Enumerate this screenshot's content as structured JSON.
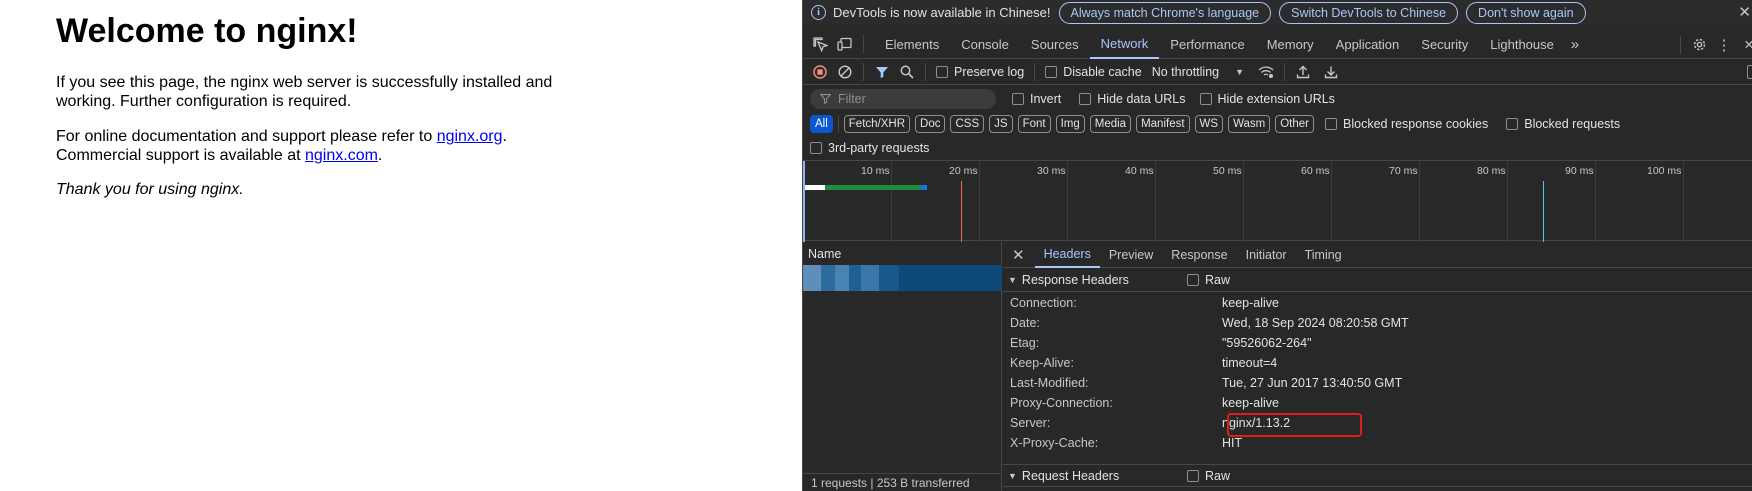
{
  "page": {
    "title": "Welcome to nginx!",
    "p1": "If you see this page, the nginx web server is successfully installed and working. Further configuration is required.",
    "p2_before": "For online documentation and support please refer to ",
    "p2_link1": "nginx.org",
    "p2_mid": ".",
    "p2_line2": "Commercial support is available at ",
    "p2_link2": "nginx.com",
    "p2_end": ".",
    "p3": "Thank you for using nginx."
  },
  "infobar": {
    "text": "DevTools is now available in Chinese!",
    "buttons": [
      "Always match Chrome's language",
      "Switch DevTools to Chinese",
      "Don't show again"
    ]
  },
  "tabs": [
    "Elements",
    "Console",
    "Sources",
    "Network",
    "Performance",
    "Memory",
    "Application",
    "Security",
    "Lighthouse"
  ],
  "active_tab": "Network",
  "toolbar": {
    "preserve_log": "Preserve log",
    "disable_cache": "Disable cache",
    "throttling": "No throttling"
  },
  "filters": {
    "placeholder": "Filter",
    "invert": "Invert",
    "hide_data": "Hide data URLs",
    "hide_ext": "Hide extension URLs",
    "types": [
      "All",
      "Fetch/XHR",
      "Doc",
      "CSS",
      "JS",
      "Font",
      "Img",
      "Media",
      "Manifest",
      "WS",
      "Wasm",
      "Other"
    ],
    "blocked_cookies": "Blocked response cookies",
    "blocked_requests": "Blocked requests",
    "third_party": "3rd-party requests"
  },
  "timeline": {
    "ticks": [
      "10 ms",
      "20 ms",
      "30 ms",
      "40 ms",
      "50 ms",
      "60 ms",
      "70 ms",
      "80 ms",
      "90 ms",
      "100 ms"
    ]
  },
  "list": {
    "name_header": "Name",
    "status": "1 requests | 253 B transferred"
  },
  "detail_tabs": [
    "Headers",
    "Preview",
    "Response",
    "Initiator",
    "Timing"
  ],
  "active_detail_tab": "Headers",
  "response_headers": {
    "title": "Response Headers",
    "raw": "Raw",
    "rows": [
      {
        "name": "Connection:",
        "value": "keep-alive"
      },
      {
        "name": "Date:",
        "value": "Wed, 18 Sep 2024 08:20:58 GMT"
      },
      {
        "name": "Etag:",
        "value": "\"59526062-264\""
      },
      {
        "name": "Keep-Alive:",
        "value": "timeout=4"
      },
      {
        "name": "Last-Modified:",
        "value": "Tue, 27 Jun 2017 13:40:50 GMT"
      },
      {
        "name": "Proxy-Connection:",
        "value": "keep-alive"
      },
      {
        "name": "Server:",
        "value": "nginx/1.13.2"
      },
      {
        "name": "X-Proxy-Cache:",
        "value": "HIT"
      }
    ]
  },
  "request_headers": {
    "title": "Request Headers",
    "raw": "Raw"
  },
  "colors": {
    "accent": "#a8c7fa",
    "highlight": "#e01d1d",
    "selected_row": "#0d4a7a"
  }
}
